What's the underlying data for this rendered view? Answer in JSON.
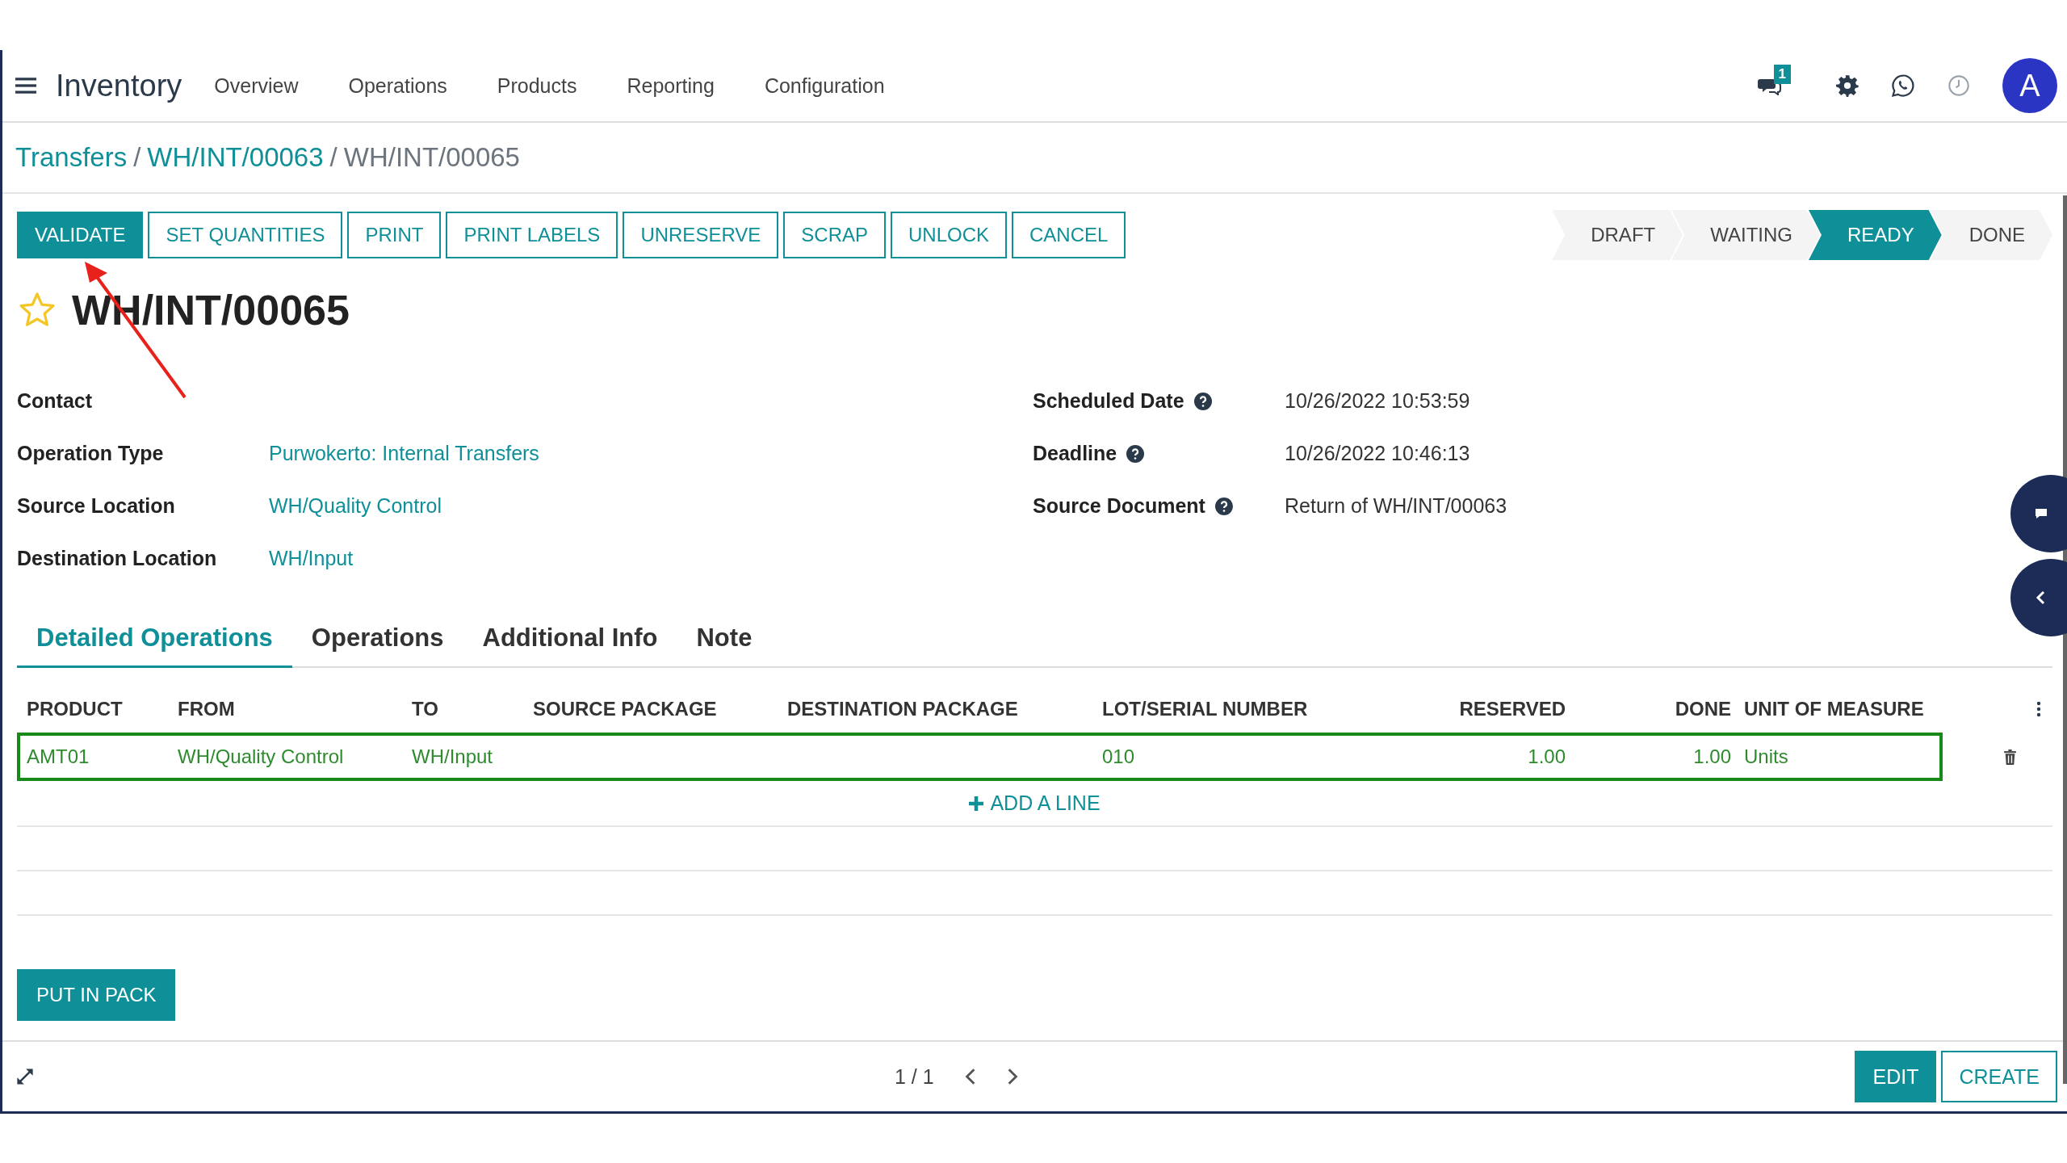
{
  "navbar": {
    "app_name": "Inventory",
    "menu": [
      "Overview",
      "Operations",
      "Products",
      "Reporting",
      "Configuration"
    ],
    "messages_badge": "1",
    "avatar": "A"
  },
  "breadcrumb": [
    {
      "label": "Transfers",
      "active": false
    },
    {
      "label": "WH/INT/00063",
      "active": false
    },
    {
      "label": "WH/INT/00065",
      "active": true
    }
  ],
  "breadcrumb_separator": "/",
  "actions": [
    {
      "label": "VALIDATE",
      "primary": true
    },
    {
      "label": "SET QUANTITIES",
      "primary": false
    },
    {
      "label": "PRINT",
      "primary": false
    },
    {
      "label": "PRINT LABELS",
      "primary": false
    },
    {
      "label": "UNRESERVE",
      "primary": false
    },
    {
      "label": "SCRAP",
      "primary": false
    },
    {
      "label": "UNLOCK",
      "primary": false
    },
    {
      "label": "CANCEL",
      "primary": false
    }
  ],
  "stages": [
    {
      "label": "DRAFT",
      "selected": false
    },
    {
      "label": "WAITING",
      "selected": false
    },
    {
      "label": "READY",
      "selected": true
    },
    {
      "label": "DONE",
      "selected": false
    }
  ],
  "record": {
    "title": "WH/INT/00065",
    "starred": false
  },
  "fields_left": [
    {
      "label": "Contact",
      "help": false
    },
    {
      "label": "Operation Type",
      "value": "Purwokerto: Internal Transfers",
      "kind": "link",
      "help": false
    },
    {
      "label": "Source Location",
      "value": "WH/Quality Control",
      "kind": "link",
      "help": false
    },
    {
      "label": "Destination Location",
      "value": "WH/Input",
      "kind": "link",
      "help": false
    }
  ],
  "fields_right": [
    {
      "label": "Scheduled Date",
      "value": "10/26/2022 10:53:59",
      "kind": "text",
      "help": true
    },
    {
      "label": "Deadline",
      "value": "10/26/2022 10:46:13",
      "kind": "text",
      "help": true
    },
    {
      "label": "Source Document",
      "value": "Return of WH/INT/00063",
      "kind": "text",
      "help": true
    }
  ],
  "tabs": [
    {
      "label": "Detailed Operations",
      "selected": true
    },
    {
      "label": "Operations",
      "selected": false
    },
    {
      "label": "Additional Info",
      "selected": false
    },
    {
      "label": "Note",
      "selected": false
    }
  ],
  "table": {
    "columns": [
      {
        "label": "PRODUCT",
        "kind": "text"
      },
      {
        "label": "FROM",
        "kind": "text"
      },
      {
        "label": "TO",
        "kind": "text"
      },
      {
        "label": "SOURCE PACKAGE",
        "kind": "text"
      },
      {
        "label": "DESTINATION PACKAGE",
        "kind": "text"
      },
      {
        "label": "LOT/SERIAL NUMBER",
        "kind": "text"
      },
      {
        "label": "RESERVED",
        "kind": "number"
      },
      {
        "label": "DONE",
        "kind": "number"
      },
      {
        "label": "UNIT OF MEASURE",
        "kind": "text"
      }
    ],
    "rows": [
      {
        "cells": [
          "AMT01",
          "WH/Quality Control",
          "WH/Input",
          "",
          "",
          "010",
          "1.00",
          "1.00",
          "Units"
        ],
        "highlighted": true
      }
    ],
    "add_line": "ADD A LINE"
  },
  "put_in_pack": "PUT IN PACK",
  "pager": "1 / 1",
  "footer_buttons": [
    {
      "label": "EDIT",
      "primary": true
    },
    {
      "label": "CREATE",
      "primary": false
    }
  ]
}
